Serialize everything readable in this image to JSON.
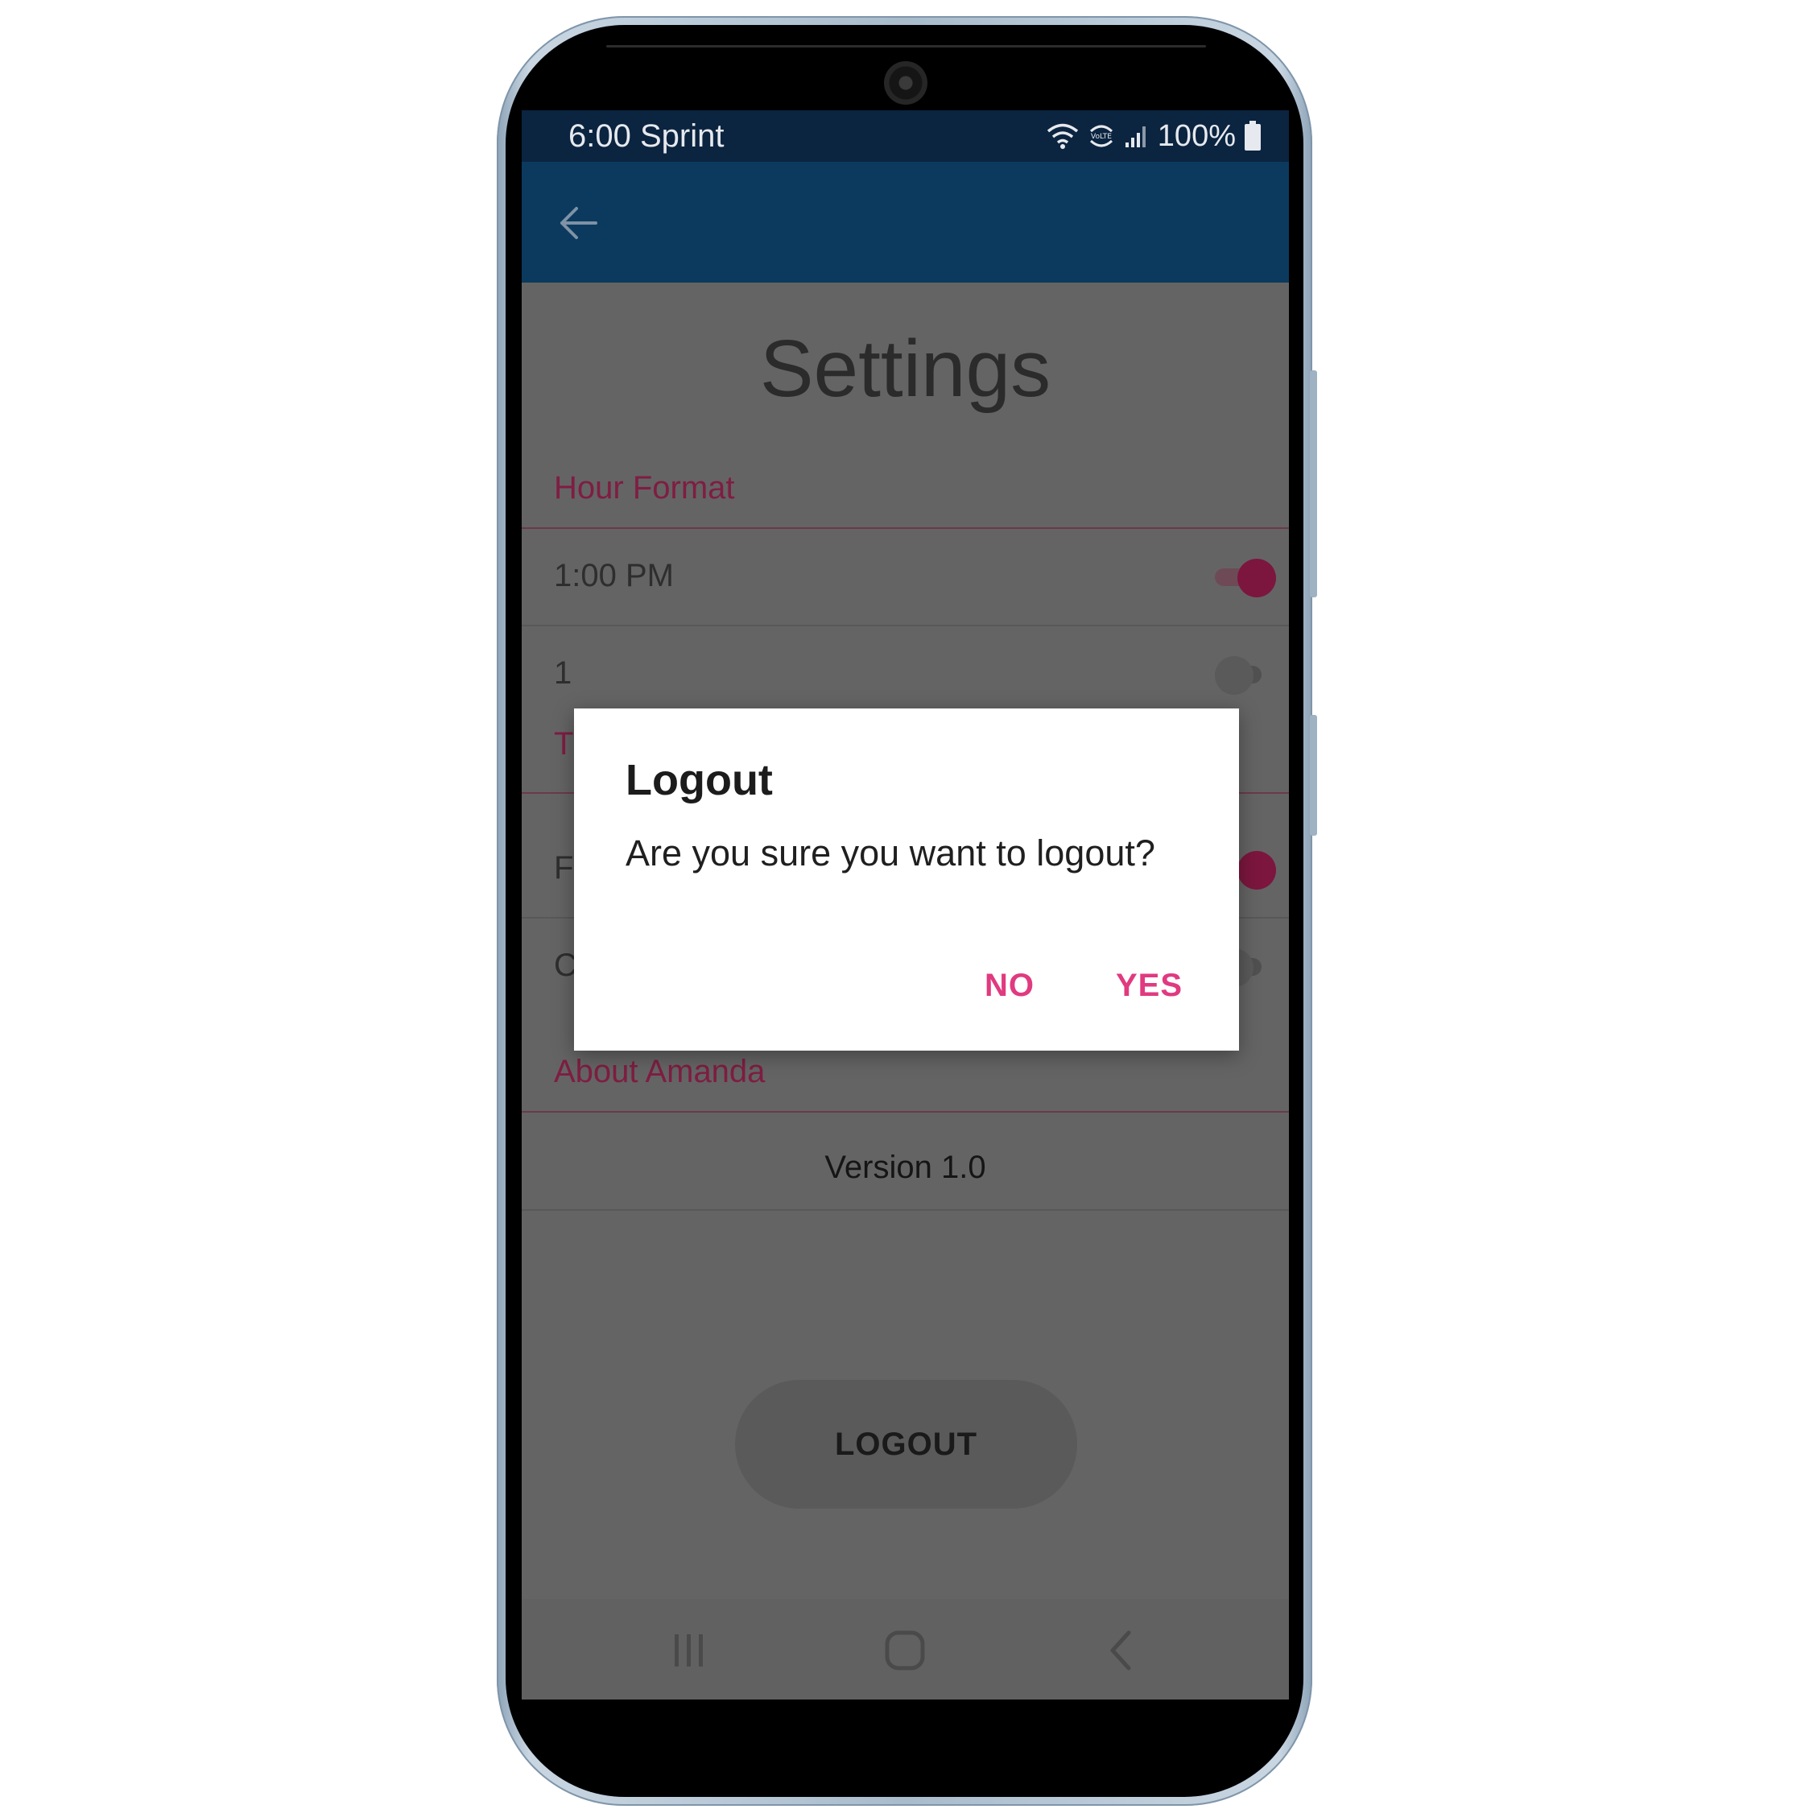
{
  "status_bar": {
    "time_carrier": "6:00 Sprint",
    "battery_percent": "100%",
    "icons": [
      "wifi-icon",
      "volte-icon",
      "signal-icon",
      "battery-icon"
    ]
  },
  "app_bar": {
    "back_icon": "arrow-left-icon"
  },
  "page": {
    "title": "Settings"
  },
  "sections": {
    "hour_format": {
      "header": "Hour Format",
      "rows": [
        {
          "label": "1:00 PM",
          "toggle_on": true
        },
        {
          "label": "1",
          "toggle_on": false
        }
      ]
    },
    "second_section": {
      "header": "T",
      "rows": [
        {
          "label": "F",
          "toggle_on": true
        },
        {
          "label": "C",
          "toggle_on": false
        }
      ]
    },
    "about": {
      "header": "About Amanda",
      "version": "Version 1.0"
    }
  },
  "logout_button": {
    "label": "LOGOUT"
  },
  "dialog": {
    "title": "Logout",
    "message": "Are you sure you want to logout?",
    "no_label": "NO",
    "yes_label": "YES"
  },
  "nav_bar": {
    "icons": [
      "recent-apps-icon",
      "home-icon",
      "back-icon"
    ]
  },
  "colors": {
    "status_bar": "#0b2440",
    "app_bar": "#0b3a5e",
    "accent": "#e03a80",
    "section_header": "#7f1d42",
    "scrim_background": "#646464"
  }
}
